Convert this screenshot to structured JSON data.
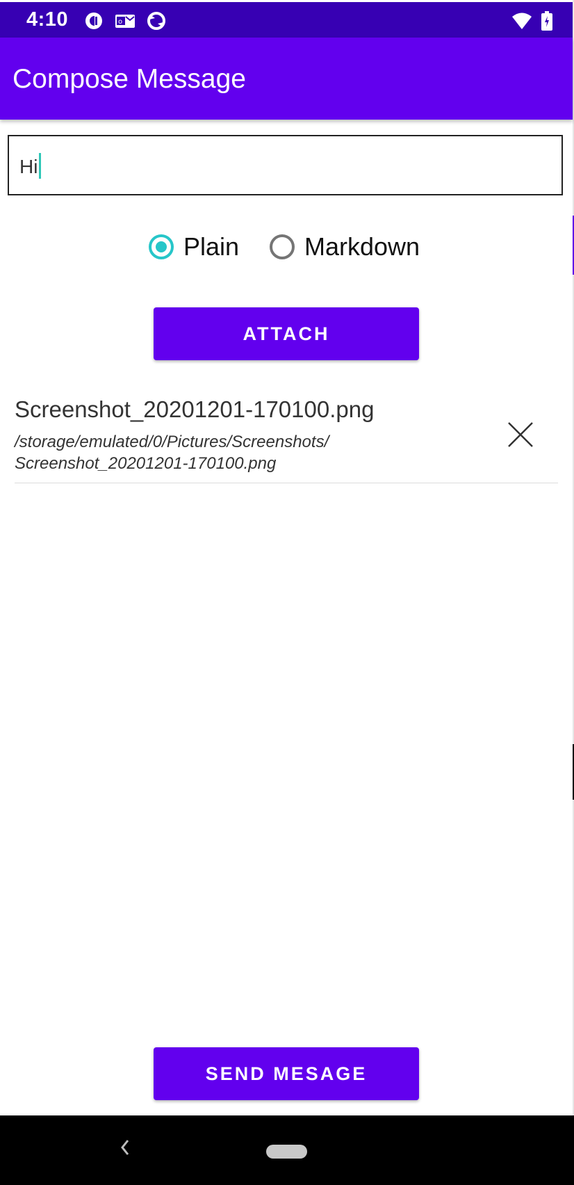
{
  "status_bar": {
    "time": "4:10",
    "left_icons": [
      "c-badge-icon",
      "mail-icon",
      "sync-icon"
    ],
    "right_icons": [
      "wifi-icon",
      "battery-icon"
    ],
    "background": "#3700b3"
  },
  "app_bar": {
    "title": "Compose Message",
    "background": "#6200ee"
  },
  "message_input": {
    "value": "Hi"
  },
  "format": {
    "options": [
      {
        "label": "Plain",
        "checked": true
      },
      {
        "label": "Markdown",
        "checked": false
      }
    ],
    "accent": "#26c6c9"
  },
  "attach_button": {
    "label": "ATTACH"
  },
  "attachments": [
    {
      "name": "Screenshot_20201201-170100.png",
      "path": "/storage/emulated/0/Pictures/Screenshots/\nScreenshot_20201201-170100.png",
      "remove_icon": "close-icon"
    }
  ],
  "send_button": {
    "label": "SEND MESAGE"
  },
  "nav_bar": {
    "icons": [
      "back-icon",
      "home-pill-icon"
    ]
  }
}
